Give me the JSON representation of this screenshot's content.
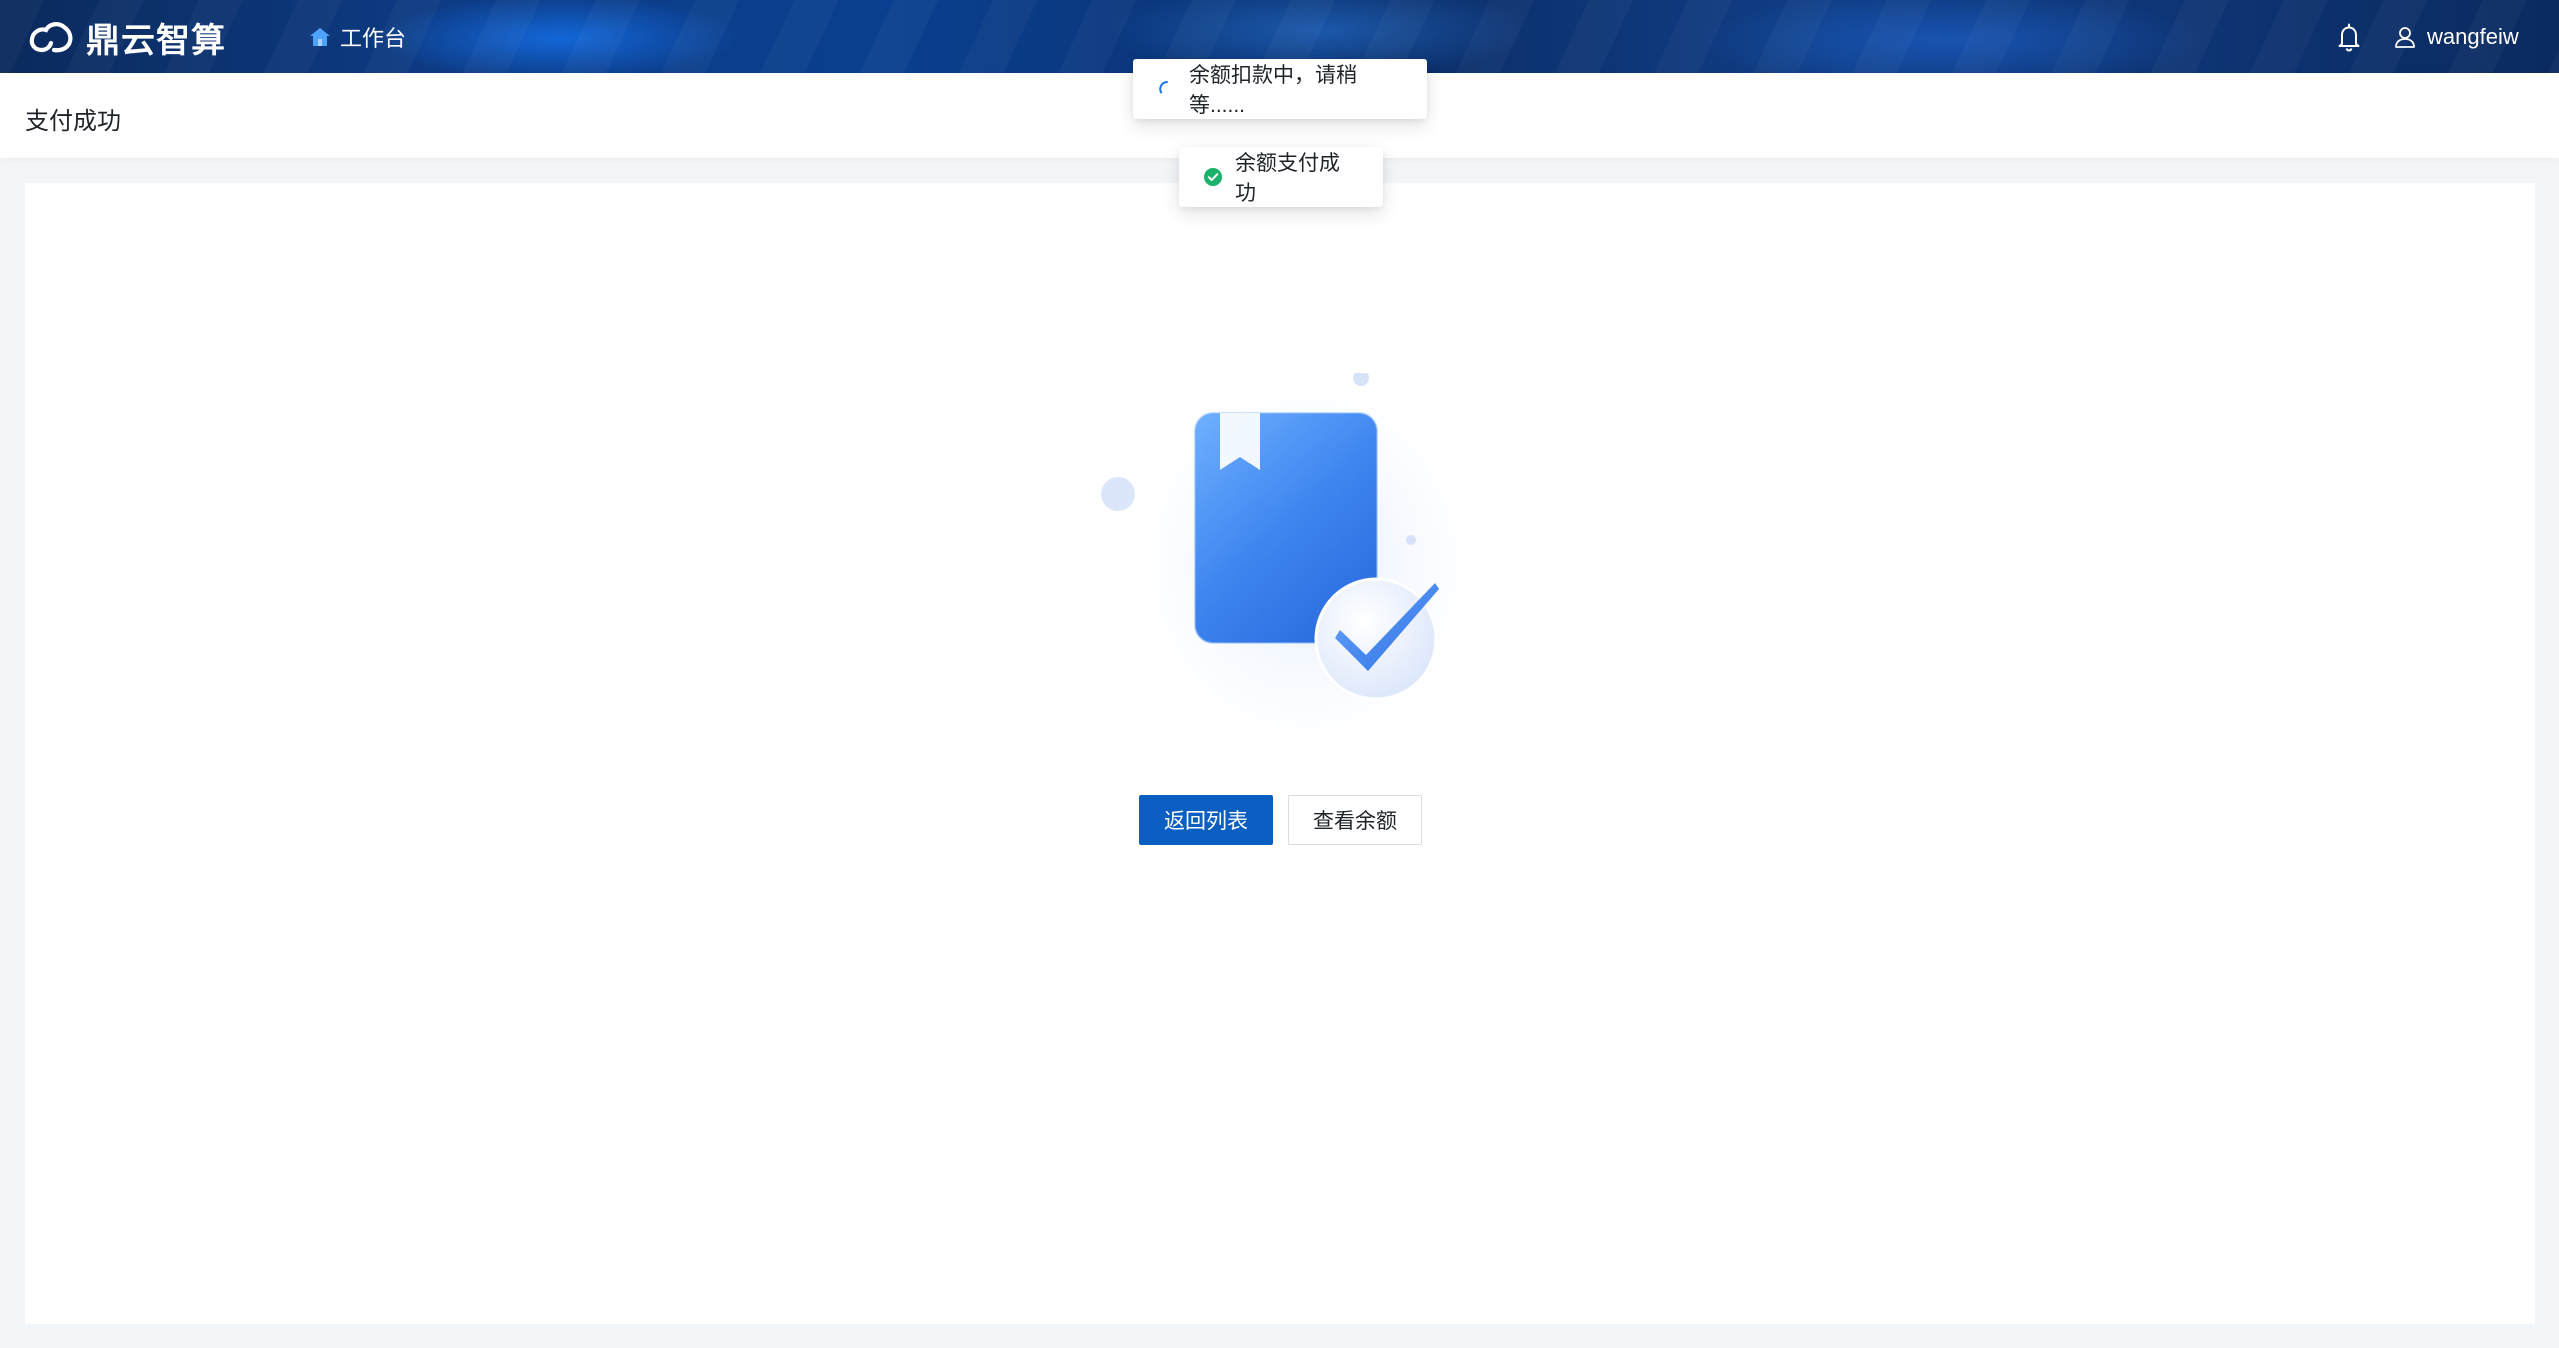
{
  "header": {
    "logo_text": "鼎云智算",
    "nav_home_label": "工作台",
    "username": "wangfeiw"
  },
  "page": {
    "title": "支付成功"
  },
  "actions": {
    "back_label": "返回列表",
    "balance_label": "查看余额"
  },
  "toasts": {
    "loading_text": "余额扣款中，请稍等......",
    "success_text": "余额支付成功"
  },
  "colors": {
    "primary": "#0b5ec2",
    "success": "#19b26b",
    "topbar": "#0c3170"
  },
  "icons": {
    "logo": "cloud-logo-icon",
    "home": "home-icon",
    "bell": "bell-icon",
    "user": "user-icon",
    "loading": "spinner-icon",
    "success": "check-circle-icon"
  }
}
